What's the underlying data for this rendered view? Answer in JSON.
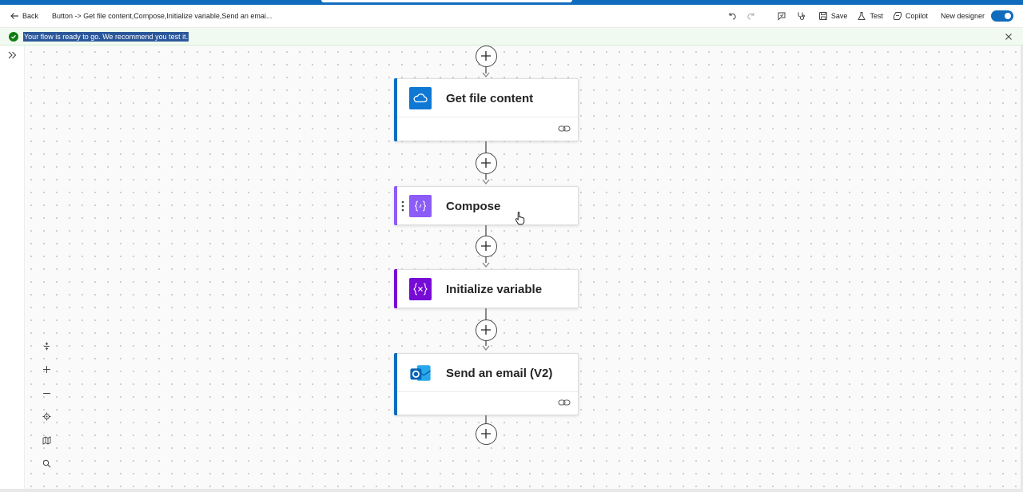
{
  "header": {
    "back_label": "Back",
    "breadcrumb": "Button -> Get file content,Compose,Initialize variable,Send an emai...",
    "save_label": "Save",
    "test_label": "Test",
    "copilot_label": "Copilot",
    "new_designer_label": "New designer",
    "new_designer_enabled": true
  },
  "banner": {
    "message": "Your flow is ready to go. We recommend you test it.",
    "status_color": "#107c10"
  },
  "canvas": {
    "steps": [
      {
        "title": "Get file content",
        "icon": "onedrive-cloud-icon",
        "accent": "#0f6cbd",
        "icon_bg": "#0f78d4",
        "has_link": true
      },
      {
        "title": "Compose",
        "icon": "compose-icon",
        "accent": "#8b5cf6",
        "icon_bg": "#8b5cf6",
        "has_link": false
      },
      {
        "title": "Initialize variable",
        "icon": "variable-icon",
        "accent": "#770bd6",
        "icon_bg": "#770bd6",
        "has_link": false
      },
      {
        "title": "Send an email (V2)",
        "icon": "outlook-icon",
        "accent": "#0f6cbd",
        "icon_bg": "#0078d4",
        "has_link": true
      }
    ]
  },
  "zoom_controls": [
    "fit-icon",
    "zoom-in-icon",
    "zoom-out-icon",
    "center-icon",
    "minimap-icon",
    "search-icon"
  ],
  "colors": {
    "brand": "#0f6cbd",
    "canvas_bg": "#fafafa"
  }
}
